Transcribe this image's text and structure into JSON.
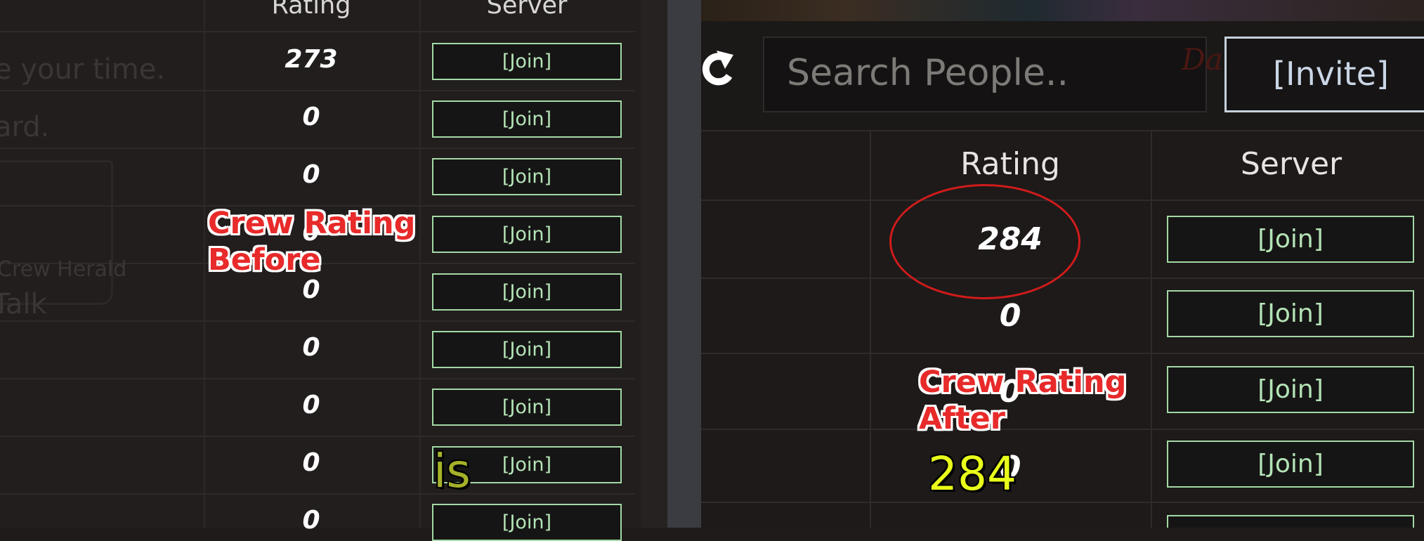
{
  "before_panel": {
    "headers": {
      "rating": "Rating",
      "server": "Server"
    },
    "background_texts": [
      "e your time.",
      "ard.",
      "Crew Herald",
      "Talk"
    ],
    "rows": [
      {
        "rating": "273",
        "join": "[Join]"
      },
      {
        "rating": "0",
        "join": "[Join]"
      },
      {
        "rating": "0",
        "join": "[Join]"
      },
      {
        "rating": "0",
        "join": "[Join]"
      },
      {
        "rating": "0",
        "join": "[Join]"
      },
      {
        "rating": "0",
        "join": "[Join]"
      },
      {
        "rating": "0",
        "join": "[Join]"
      },
      {
        "rating": "0",
        "join": "[Join]"
      },
      {
        "rating": "0",
        "join": "[Join]"
      }
    ]
  },
  "after_panel": {
    "search_placeholder": "Search People..",
    "invite_label": "[Invite]",
    "background_script": "Dalliance",
    "headers": {
      "rating": "Rating",
      "server": "Server"
    },
    "rows": [
      {
        "rating": "284",
        "join": "[Join]"
      },
      {
        "rating": "0",
        "join": "[Join]"
      },
      {
        "rating": "0",
        "join": "[Join]"
      },
      {
        "rating": "0",
        "join": "[Join]"
      }
    ],
    "highlight_color": "#d11b1b"
  },
  "annotations": {
    "before_label_line1": "Crew Rating",
    "before_label_line2": "Before",
    "after_label_line1": "Crew Rating",
    "after_label_line2": "After",
    "label_color": "#e82a2a"
  },
  "captions": {
    "word": "is",
    "word_color": "#a5b129",
    "value": "284",
    "value_color": "#e9ff1a"
  }
}
